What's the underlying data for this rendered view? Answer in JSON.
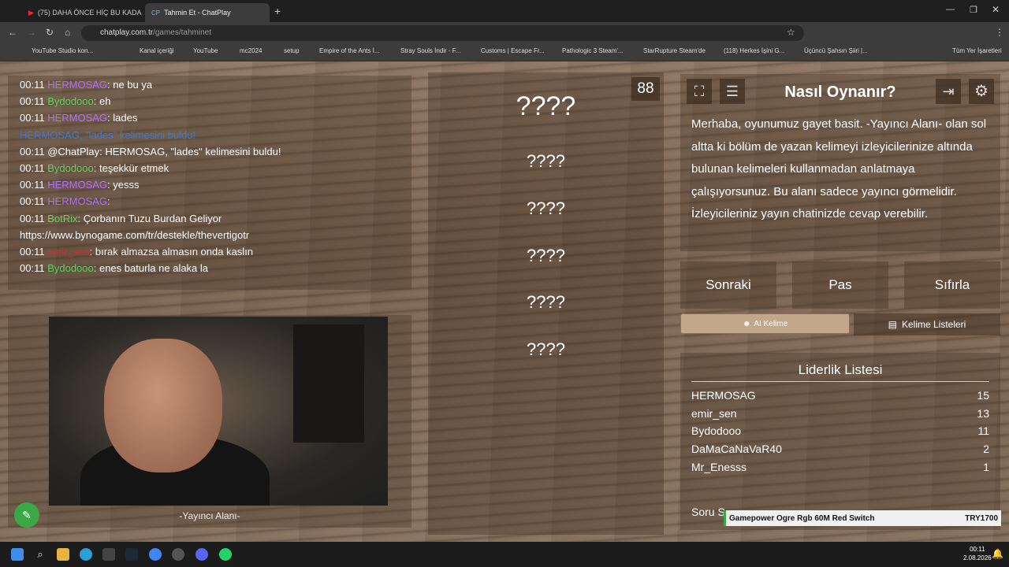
{
  "browser": {
    "tab1": "(75) DAHA ÖNCE HİÇ BU KADA",
    "tab2": "Tahmin Et - ChatPlay",
    "url_host": "chatplay.com.tr",
    "url_path": "/games/tahminet"
  },
  "bookmarks": [
    "YouTube Studio kon...",
    "Kanal içeriği",
    "YouTube",
    "mc2024",
    "setup",
    "Empire of the Ants İ...",
    "Stray Souls İndir - F...",
    "Customs | Escape Fr...",
    "Pathologic 3 Steam'...",
    "StarRupture Steam'de",
    "(118) Herkes İşini G...",
    "Üçüncü Şahsın Şiiri |..."
  ],
  "bookmarks_all": "Tüm Yer İşaretleri",
  "chat": [
    {
      "t": "00:11 ",
      "u": "HERMOSAG",
      "uc": "#b06cff",
      "m": ": ne bu ya"
    },
    {
      "t": "00:11 ",
      "u": "Bydodooo",
      "uc": "#5fd35f",
      "m": ": eh"
    },
    {
      "t": "00:11 ",
      "u": "HERMOSAG",
      "uc": "#b06cff",
      "m": ": lades"
    },
    {
      "t": "",
      "u": "HERMOSAG, \"lades\" kelimesini buldu!",
      "uc": "#3a7bd5",
      "m": ""
    },
    {
      "t": "00:11 ",
      "u": "@ChatPlay",
      "uc": "#ffffff",
      "m": ": HERMOSAG, \"lades\" kelimesini buldu!"
    },
    {
      "t": "00:11 ",
      "u": "Bydodooo",
      "uc": "#5fd35f",
      "m": ": teşekkür etmek"
    },
    {
      "t": "00:11 ",
      "u": "HERMOSAG",
      "uc": "#b06cff",
      "m": ": yesss"
    },
    {
      "t": "00:11 ",
      "u": "HERMOSAG",
      "uc": "#b06cff",
      "m": ":"
    },
    {
      "t": "00:11 ",
      "u": "BotRix",
      "uc": "#5fd35f",
      "m": ": Çorbanın Tuzu Burdan Geliyor"
    },
    {
      "t": "",
      "u": "",
      "uc": "#ffffff",
      "m": "https://www.bynogame.com/tr/destekle/thevertigotr"
    },
    {
      "t": "00:11 ",
      "u": "emir_sen",
      "uc": "#d42a2a",
      "m": ": bırak almazsa almasın onda kaslın"
    },
    {
      "t": "00:11 ",
      "u": "Bydodooo",
      "uc": "#5fd35f",
      "m": ": enes baturla ne alaka la"
    }
  ],
  "streamer_label": "-Yayıncı Alanı-",
  "timer": "88",
  "words": [
    "????",
    "????",
    "????",
    "????",
    "????",
    "????"
  ],
  "help": {
    "title": "Nasıl Oynanır?",
    "text": "Merhaba, oyunumuz gayet basit. -Yayıncı Alanı- olan sol altta ki bölüm de yazan kelimeyi izleyicilerinize altında bulunan kelimeleri kullanmadan anlatmaya çalışıyorsunuz. Bu alanı sadece yayıncı görmelidir. İzleyicileriniz yayın chatinizde cevap verebilir."
  },
  "buttons": {
    "next": "Sonraki",
    "pass": "Pas",
    "reset": "Sıfırla",
    "ai": "AI Kelime",
    "lists": "Kelime Listeleri"
  },
  "leaderboard": {
    "title": "Liderlik Listesi",
    "rows": [
      {
        "n": "HERMOSAG",
        "s": "15"
      },
      {
        "n": "emir_sen",
        "s": "13"
      },
      {
        "n": "Bydodooo",
        "s": "11"
      },
      {
        "n": "DaMaCaNaVaR40",
        "s": "2"
      },
      {
        "n": "Mr_Enesss",
        "s": "1"
      }
    ]
  },
  "soru": "Soru S",
  "ad": {
    "text": "Gamepower Ogre Rgb 60M Red Switch",
    "price": "TRY1700"
  },
  "clock": {
    "time": "00:11",
    "date": "2.08.2026"
  }
}
